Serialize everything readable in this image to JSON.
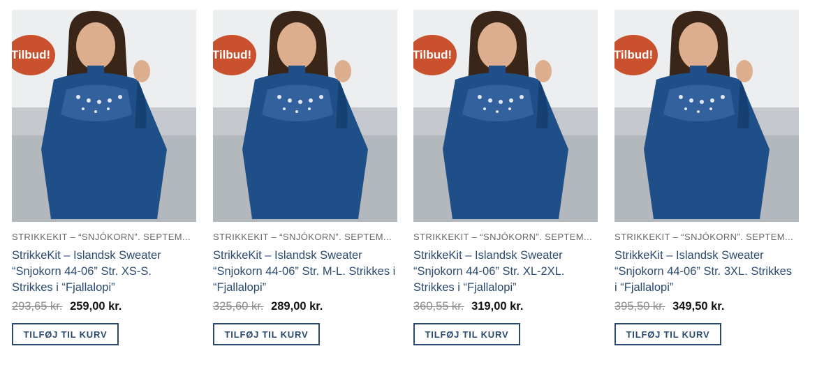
{
  "colors": {
    "badge": "#c9512e",
    "title": "#2b4a6f",
    "button_border": "#2b4a6f",
    "sweater": "#1e4f89"
  },
  "products": [
    {
      "badge": "Tilbud!",
      "category": "STRIKKEKIT – “SNJÓKORN”. SEPTEM...",
      "title": "StrikkeKit – Islandsk Sweater “Snjokorn 44-06” Str. XS-S. Strikkes i “Fjallalopi”",
      "old_price": "293,65 kr.",
      "new_price": "259,00 kr.",
      "button": "TILFØJ TIL KURV",
      "image_icon": "sweater-photo"
    },
    {
      "badge": "Tilbud!",
      "category": "STRIKKEKIT – “SNJÓKORN”. SEPTEM...",
      "title": "StrikkeKit – Islandsk Sweater “Snjokorn 44-06” Str. M-L. Strikkes i “Fjallalopi”",
      "old_price": "325,60 kr.",
      "new_price": "289,00 kr.",
      "button": "TILFØJ TIL KURV",
      "image_icon": "sweater-photo"
    },
    {
      "badge": "Tilbud!",
      "category": "STRIKKEKIT – “SNJÓKORN”. SEPTEM...",
      "title": "StrikkeKit – Islandsk Sweater “Snjokorn 44-06” Str. XL-2XL. Strikkes i “Fjallalopi”",
      "old_price": "360,55 kr.",
      "new_price": "319,00 kr.",
      "button": "TILFØJ TIL KURV",
      "image_icon": "sweater-photo"
    },
    {
      "badge": "Tilbud!",
      "category": "STRIKKEKIT – “SNJÓKORN”. SEPTEM...",
      "title": "StrikkeKit – Islandsk Sweater “Snjokorn 44-06” Str. 3XL. Strikkes i “Fjallalopi”",
      "old_price": "395,50 kr.",
      "new_price": "349,50 kr.",
      "button": "TILFØJ TIL KURV",
      "image_icon": "sweater-photo"
    }
  ]
}
